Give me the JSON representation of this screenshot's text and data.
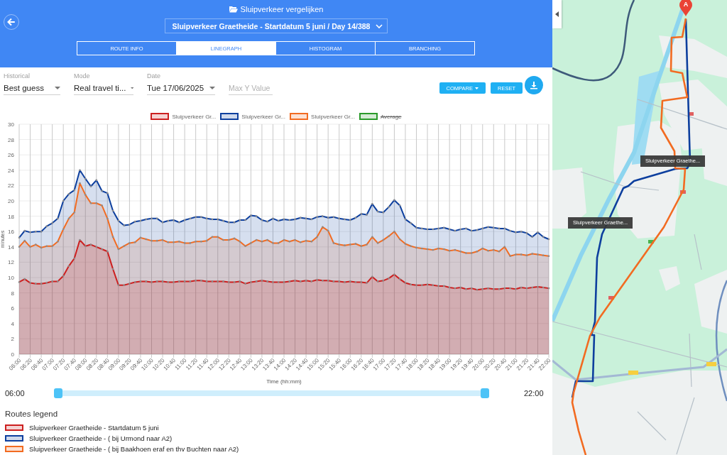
{
  "header": {
    "title": "Sluipverkeer vergelijken",
    "selector": {
      "value": "Sluipverkeer Graetheide - Startdatum 5 juni / Day 14/388"
    },
    "tabs": [
      {
        "label": "ROUTE INFO",
        "selected": false
      },
      {
        "label": "LINEGRAPH",
        "selected": true
      },
      {
        "label": "HISTOGRAM",
        "selected": false
      },
      {
        "label": "BRANCHING",
        "selected": false
      }
    ]
  },
  "filters": [
    {
      "kind": "select",
      "label": "Historical",
      "value": "Best guess"
    },
    {
      "kind": "select",
      "label": "Mode",
      "value": "Real travel ti..."
    },
    {
      "kind": "select",
      "label": "Date",
      "value": "Tue 17/06/2025"
    },
    {
      "kind": "input",
      "placeholder": "Max Y Value"
    }
  ],
  "actions": [
    {
      "kind": "dropdown",
      "label": "COMPARE"
    },
    {
      "kind": "plain",
      "label": "RESET"
    },
    {
      "kind": "download"
    }
  ],
  "chart": {
    "chart_data": {
      "type": "area",
      "grid": true,
      "xlabel": "Time (hh:mm)",
      "ylabel": "minutes",
      "x": [
        360,
        370,
        380,
        390,
        400,
        410,
        420,
        430,
        440,
        450,
        460,
        470,
        480,
        490,
        500,
        510,
        520,
        530,
        540,
        550,
        560,
        570,
        580,
        590,
        600,
        610,
        620,
        630,
        640,
        650,
        660,
        670,
        680,
        690,
        700,
        710,
        720,
        730,
        740,
        750,
        760,
        770,
        780,
        790,
        800,
        810,
        820,
        830,
        840,
        850,
        860,
        870,
        880,
        890,
        900,
        910,
        920,
        930,
        940,
        950,
        960,
        970,
        980,
        990,
        1000,
        1010,
        1020,
        1030,
        1040,
        1050,
        1060,
        1070,
        1080,
        1090,
        1100,
        1110,
        1120,
        1130,
        1140,
        1150,
        1160,
        1170,
        1180,
        1190,
        1200,
        1210,
        1220,
        1230,
        1240,
        1250,
        1260,
        1270,
        1280,
        1290,
        1300,
        1310,
        1320
      ],
      "xlim": [
        360,
        1320
      ],
      "xticks": [
        {
          "value": 360,
          "label": "06:00"
        },
        {
          "value": 380,
          "label": "06:20"
        },
        {
          "value": 400,
          "label": "06:40"
        },
        {
          "value": 420,
          "label": "07:00"
        },
        {
          "value": 440,
          "label": "07:20"
        },
        {
          "value": 460,
          "label": "07:40"
        },
        {
          "value": 480,
          "label": "08:00"
        },
        {
          "value": 500,
          "label": "08:20"
        },
        {
          "value": 520,
          "label": "08:40"
        },
        {
          "value": 540,
          "label": "09:00"
        },
        {
          "value": 560,
          "label": "09:20"
        },
        {
          "value": 580,
          "label": "09:40"
        },
        {
          "value": 600,
          "label": "10:00"
        },
        {
          "value": 620,
          "label": "10:20"
        },
        {
          "value": 640,
          "label": "10:40"
        },
        {
          "value": 660,
          "label": "11:00"
        },
        {
          "value": 680,
          "label": "11:20"
        },
        {
          "value": 700,
          "label": "11:40"
        },
        {
          "value": 720,
          "label": "12:00"
        },
        {
          "value": 740,
          "label": "12:20"
        },
        {
          "value": 760,
          "label": "12:40"
        },
        {
          "value": 780,
          "label": "13:00"
        },
        {
          "value": 800,
          "label": "13:20"
        },
        {
          "value": 820,
          "label": "13:40"
        },
        {
          "value": 840,
          "label": "14:00"
        },
        {
          "value": 860,
          "label": "14:20"
        },
        {
          "value": 880,
          "label": "14:40"
        },
        {
          "value": 900,
          "label": "15:00"
        },
        {
          "value": 920,
          "label": "15:20"
        },
        {
          "value": 940,
          "label": "15:40"
        },
        {
          "value": 960,
          "label": "16:00"
        },
        {
          "value": 980,
          "label": "16:20"
        },
        {
          "value": 1000,
          "label": "16:40"
        },
        {
          "value": 1020,
          "label": "17:00"
        },
        {
          "value": 1040,
          "label": "17:20"
        },
        {
          "value": 1060,
          "label": "17:40"
        },
        {
          "value": 1080,
          "label": "18:00"
        },
        {
          "value": 1100,
          "label": "18:20"
        },
        {
          "value": 1120,
          "label": "18:40"
        },
        {
          "value": 1140,
          "label": "19:00"
        },
        {
          "value": 1160,
          "label": "19:20"
        },
        {
          "value": 1180,
          "label": "19:40"
        },
        {
          "value": 1200,
          "label": "20:00"
        },
        {
          "value": 1220,
          "label": "20:20"
        },
        {
          "value": 1240,
          "label": "20:40"
        },
        {
          "value": 1260,
          "label": "21:00"
        },
        {
          "value": 1280,
          "label": "21:20"
        },
        {
          "value": 1300,
          "label": "21:40"
        },
        {
          "value": 1320,
          "label": "22:00"
        }
      ],
      "ylim": [
        0,
        30
      ],
      "yticks": [
        0,
        2,
        4,
        6,
        8,
        10,
        12,
        14,
        16,
        18,
        20,
        22,
        24,
        26,
        28,
        30
      ],
      "series": [
        {
          "name": "Sluipverkeer Gr...",
          "color": "#cc1f1f",
          "values": [
            9.4,
            9.8,
            9.3,
            9.2,
            9.2,
            9.3,
            9.5,
            9.5,
            10.2,
            11.5,
            12.5,
            14.9,
            14.1,
            14.3,
            14.0,
            13.7,
            13.4,
            11.1,
            9.0,
            9.0,
            9.2,
            9.4,
            9.5,
            9.5,
            9.4,
            9.5,
            9.5,
            9.4,
            9.4,
            9.5,
            9.5,
            9.5,
            9.6,
            9.6,
            9.5,
            9.5,
            9.5,
            9.5,
            9.4,
            9.4,
            9.5,
            9.2,
            9.4,
            9.5,
            9.6,
            9.5,
            9.4,
            9.4,
            9.4,
            9.5,
            9.6,
            9.5,
            9.6,
            9.5,
            9.7,
            9.6,
            9.6,
            9.5,
            9.5,
            9.4,
            9.5,
            9.4,
            9.4,
            9.3,
            10.1,
            9.5,
            9.6,
            9.9,
            10.4,
            9.8,
            9.3,
            9.1,
            9.0,
            9.0,
            9.1,
            9.0,
            8.9,
            8.9,
            8.7,
            8.6,
            8.7,
            8.5,
            8.6,
            8.4,
            8.5,
            8.6,
            8.5,
            8.5,
            8.6,
            8.6,
            8.5,
            8.7,
            8.6,
            8.7,
            8.8,
            8.7,
            8.6
          ]
        },
        {
          "name": "Sluipverkeer Gr...",
          "color": "#0d3f9e",
          "values": [
            15.2,
            16.1,
            15.9,
            16.0,
            16.0,
            16.7,
            17.1,
            17.7,
            20.0,
            20.9,
            21.4,
            24.0,
            22.9,
            21.9,
            22.7,
            21.3,
            21.0,
            18.7,
            17.4,
            16.8,
            16.9,
            17.3,
            17.4,
            17.6,
            17.7,
            17.7,
            17.2,
            17.4,
            17.5,
            17.2,
            17.5,
            17.7,
            17.9,
            17.9,
            17.7,
            17.6,
            17.6,
            17.4,
            17.2,
            17.2,
            17.5,
            17.5,
            18.1,
            18.0,
            17.5,
            17.3,
            17.7,
            17.4,
            17.6,
            17.5,
            17.6,
            17.8,
            17.7,
            17.6,
            17.9,
            18.0,
            17.8,
            17.9,
            17.7,
            17.6,
            17.5,
            17.8,
            18.3,
            18.2,
            19.6,
            18.6,
            18.5,
            19.2,
            20.1,
            19.4,
            17.6,
            17.1,
            16.5,
            16.4,
            16.3,
            16.3,
            16.4,
            16.5,
            16.3,
            16.1,
            16.3,
            16.4,
            16.1,
            16.2,
            16.4,
            16.6,
            16.5,
            16.4,
            16.4,
            16.1,
            15.9,
            16.0,
            15.8,
            15.3,
            15.9,
            15.3,
            15.0
          ]
        },
        {
          "name": "Sluipverkeer Gr...",
          "color": "#f26b21",
          "values": [
            14.0,
            14.8,
            14.0,
            14.3,
            13.9,
            14.1,
            14.1,
            14.7,
            16.3,
            17.7,
            18.5,
            22.3,
            20.8,
            19.7,
            19.7,
            19.4,
            17.7,
            15.3,
            13.7,
            14.1,
            14.5,
            14.6,
            15.2,
            15.0,
            14.8,
            14.8,
            14.9,
            14.6,
            14.6,
            14.7,
            14.5,
            14.5,
            14.7,
            14.7,
            14.8,
            15.3,
            15.3,
            14.9,
            14.9,
            15.1,
            14.7,
            14.1,
            14.5,
            14.9,
            14.7,
            14.9,
            14.5,
            14.5,
            14.9,
            14.7,
            14.9,
            14.6,
            14.8,
            14.7,
            15.3,
            16.6,
            16.1,
            14.5,
            14.3,
            14.2,
            14.3,
            14.4,
            14.1,
            14.3,
            15.3,
            14.5,
            14.9,
            15.4,
            16.0,
            15.0,
            14.4,
            14.1,
            13.9,
            13.8,
            13.7,
            13.6,
            13.8,
            13.7,
            13.5,
            13.6,
            13.4,
            13.2,
            13.2,
            13.4,
            13.8,
            13.5,
            13.6,
            13.4,
            14.0,
            12.8,
            13.0,
            13.0,
            12.9,
            13.1,
            13.0,
            12.9,
            12.8
          ]
        }
      ]
    },
    "legend_extra": [
      {
        "label": "Average",
        "color": "#2a9a2a",
        "hidden": true
      }
    ]
  },
  "time_range": {
    "start": "06:00",
    "end": "22:00",
    "handles": [
      {
        "level": 0
      },
      {
        "level": 1
      }
    ]
  },
  "routes_legend": {
    "title": "Routes legend",
    "items": [
      {
        "label": "Sluipverkeer Graetheide - Startdatum 5 juni",
        "color": "#cc1f1f"
      },
      {
        "label": "Sluipverkeer Graetheide - ( bij Urmond naar A2)",
        "color": "#0d3f9e"
      },
      {
        "label": "Sluipverkeer Graetheide - ( bij Baakhoen eraf en thv Buchten naar A2)",
        "color": "#f26b21"
      }
    ]
  },
  "map": {
    "marker": {
      "label": "A"
    },
    "route_labels": [
      "Sluipverkeer Graethe...",
      "Sluipverkeer Graethe..."
    ]
  }
}
